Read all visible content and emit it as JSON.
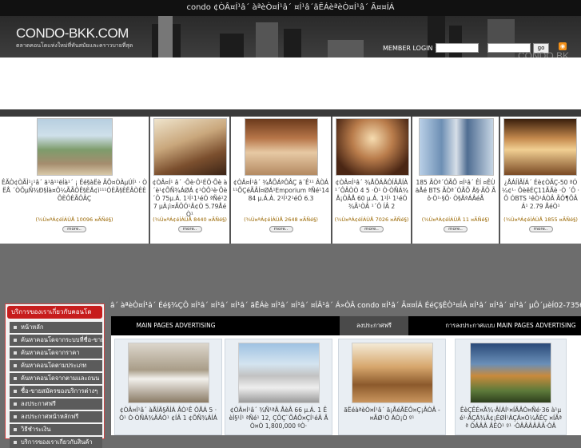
{
  "top_bar": {
    "text": "condo ¢ÒÂ¤Í¹â´ àªèÒ¤Í¹â´ ¤Í¹â´ãËÁèªèÒ¤Í¹â´ Ã¤¤ÍÁ"
  },
  "header": {
    "logo": "CONDO-BKK.COM",
    "slogan": "ตลาดคอนโดแห่งใหม่ที่ทันสมัยและคราวบายที่สุด",
    "login_label": "MEMBER LOGIN :",
    "go_label": "go",
    "rss_icon": "rss-icon",
    "watermark": "CONDO BK"
  },
  "listings": [
    {
      "text": "ÊÃÒ¢ÒÃÌ¹¡¹â´ ä¹ã¹¹ëÍà¹´ ¡ Êé§àËè ÃÕ¤ÒÀµÚÍ¹ · ÒËÅ ´ÒÕµÑ¾Ð§Ìà¤Ô¼ÃÃÔÊ§ÈÄ¢ì¹¹¹ÓÈÃ§ÈËÂÒÈÈÕÈÔÈÃÔÂÇ",
      "views": "(¾Ù¤ªÁ¢éÍÁÙÅ 10096 ¤ÃÑé§)",
      "more": "more.."
    },
    {
      "text": "¢ÒÂ¤Í¹ â´ ·Õè·Ô¹ÉÕ·Õè à ´è¹¢ÕÑ¾ÁØÁ ¢¹ÒÔ¹è·Õè´Ô 75µ.Á. 1¹Í¹1¹éÓ ªÑé¹27 µÀ¡ì¤ÃÔÓ¹Ä¢Ò 5.79ÅéÒ¹",
      "views": "(¾Ù¤ªÁ¢éÍÁÙÅ 8440 ¤ÃÑé§)",
      "more": "more.."
    },
    {
      "text": "¢ÒÂ¤Í¹â´ ¾ÅÕÁªÔÂÇ ä´Ê¹¹ ÂÒÁ¹¹ÕÇéÃÂÍ¤ØÁ¹Emporium ªÑé¹14 84 µ.Á.À. 2¹Í¹2¹éÓ 6.3",
      "views": "(¾Ù¤ªÁ¢éÍÁÙÅ 2648 ¤ÃÑé§)",
      "more": "more.."
    },
    {
      "text": "¢ÒÂ¤Í¹â´ ¾ÅÕÁÄÔÍÂÅÍÀ ¹´ÔÂÒÒ 4 5 ·Ò¹ Ò·ÒÑÁ¾Ä¡ÒÂÅ 60 µ.Á. 1¹Í¹ 1¹éÓ ¾Ã¹ÒÂ ¹´Ô ÍÂ 2",
      "views": "(¾Ù¤ªÁ¢éÍÁÙÅ 7026 ¤ÃÑé§)",
      "more": "more.."
    },
    {
      "text": "185 ÃÒª´ÓÃÕ ¤Í¹â´ ÊÍ ¤ÊÙ äÅé BTS ÃÒª´ÓÃÕ Ä§·ÃÔ Ãô·Ò¹·§Ô· Ò§ÄªÁÂéÃ",
      "views": "(¾Ù¤ªÁ¢éÍÁÙÅ 11 ¤ÃÑé§)",
      "more": "more.."
    },
    {
      "text": "¿ÅÁÍÌÃÍÁ´ Éè¢ÒÃÇ-50 ªÓ¼¢¹· ÔèêÉÇ11ÃÃè ·Ò ´Ô ·Ô ÓBTS ¹êÒ¹ÁÒÂ ÃÔ¶ÕÂÁ¹ 2.79 ÅéÒ¹",
      "views": "(¾Ù¤ªÁ¢éÍÁÙÅ 1855 ¤ÃÑé§)",
      "more": "more.."
    }
  ],
  "left_panel": {
    "title": "บริการของเราเกี่ยวกับคอนโด",
    "items": [
      "หน้าหลัก",
      "ค้นหาคอนโดจากระบบที่ชื่อ-ขาย",
      "ค้นหาคอนโดจากราคา",
      "ค้นหาคอนโดตามประเภท",
      "ค้นหาคอนโดจากตามและถนน",
      "ซื้อ-ขายสมัครของบริการต่างๆ",
      "ลงประกาศฟรี",
      "ลงประกาศหน้าหลักฟรี",
      "วิธีชำระเงิน",
      "บริการของเราเกี่ยวกับสินค้า"
    ]
  },
  "marquee": {
    "text": "â´ àªèÒ¤Í¹â´ Éé§¾ÇÔ ¤Í¹â´ ¤Í¹â´ ¤Í¹â´ ãËÁè ¤Í¹â´ ¤Í¹â´ ¤ÍÂ¹â´ Á»ÒÂ condo ¤Í¹â´ Ã¤¤ÍÁ ÉéÇ§ÊÒ¹¤ÍÁ ¤Í¹â´ ¤Í¹â´ ¤Í¹â´ µÔ´µèÍ02-735651"
  },
  "tabs": [
    {
      "label": "MAIN PAGES ADVERTISING"
    },
    {
      "label": "ลงประกาศฟรี"
    },
    {
      "label": "การลงประกาศแบบ MAIN PAGES ADVERTISING"
    }
  ],
  "ads": [
    {
      "text": "¢ÒÂ¤Í¹â´ àÅÍÄ§ÃÍÁ ÂÒ¹Ê ÔÅÁ 5 ·Ò¹ Ò·ÒÑÁ¾ÄÂÒ¹ ¢ÍÂ 1 ¢ÕÑ¾ÁÍÁ"
    },
    {
      "text": "¢ÒÂ¤Í¹â´ ¾Ñ¹ªÂ ÅèÂ 66 µ.Á. 1 ÊèÍ§¹Í¹ ªÑé¹ 12, ÇÔÇ¨ÕÁÕ¤ÇÍ¹éÂ ÃÒ¤Ò 1,800,000 ºÒ·"
    },
    {
      "text": "ãËéàªèÒ¤Í¹â´ ã¡ÅéÃËÔ¤Ç¡ÂÒÂ - ¤ÃØ¹Ò ÀÒ¡Ò º¹"
    },
    {
      "text": "ÊèÇÊÉ¤Ã¾·ÂÍÁÍ¹¤ÍÃÂÒ¤Ñé·36 à¹µé¹·ÃÇÁ¾Ä¢¡ÈØÍ¹ÀÇÁ¤Ò¼ÃÉÇ ¤ÍÃªª ÔÂÂÂ ÂÊÒ¹ º¹ ·ÒÂÂÂÂÂÂ·ÒÂ"
    }
  ]
}
